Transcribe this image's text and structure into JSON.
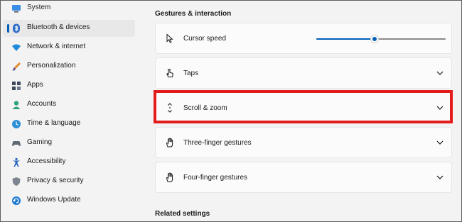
{
  "sidebar": {
    "items": [
      {
        "label": "System",
        "icon": "monitor-icon",
        "selected": false
      },
      {
        "label": "Bluetooth & devices",
        "icon": "bluetooth-icon",
        "selected": true
      },
      {
        "label": "Network & internet",
        "icon": "wifi-icon",
        "selected": false
      },
      {
        "label": "Personalization",
        "icon": "brush-icon",
        "selected": false
      },
      {
        "label": "Apps",
        "icon": "apps-icon",
        "selected": false
      },
      {
        "label": "Accounts",
        "icon": "person-icon",
        "selected": false
      },
      {
        "label": "Time & language",
        "icon": "globe-clock-icon",
        "selected": false
      },
      {
        "label": "Gaming",
        "icon": "gamepad-icon",
        "selected": false
      },
      {
        "label": "Accessibility",
        "icon": "accessibility-icon",
        "selected": false
      },
      {
        "label": "Privacy & security",
        "icon": "shield-icon",
        "selected": false
      },
      {
        "label": "Windows Update",
        "icon": "update-icon",
        "selected": false
      }
    ]
  },
  "main": {
    "section_title": "Gestures & interaction",
    "cards": [
      {
        "label": "Cursor speed",
        "icon": "cursor-icon",
        "control": "slider"
      },
      {
        "label": "Taps",
        "icon": "tap-icon",
        "control": "chevron"
      },
      {
        "label": "Scroll & zoom",
        "icon": "scroll-icon",
        "control": "chevron",
        "highlighted": true
      },
      {
        "label": "Three-finger gestures",
        "icon": "hand-icon",
        "control": "chevron"
      },
      {
        "label": "Four-finger gestures",
        "icon": "hand-icon",
        "control": "chevron"
      }
    ],
    "cursor_speed_fraction": 0.45,
    "related_title": "Related settings"
  },
  "colors": {
    "accent": "#005fb8",
    "highlight": "#e21b1b",
    "background": "#f3f3f3",
    "card": "#fbfbfb"
  }
}
